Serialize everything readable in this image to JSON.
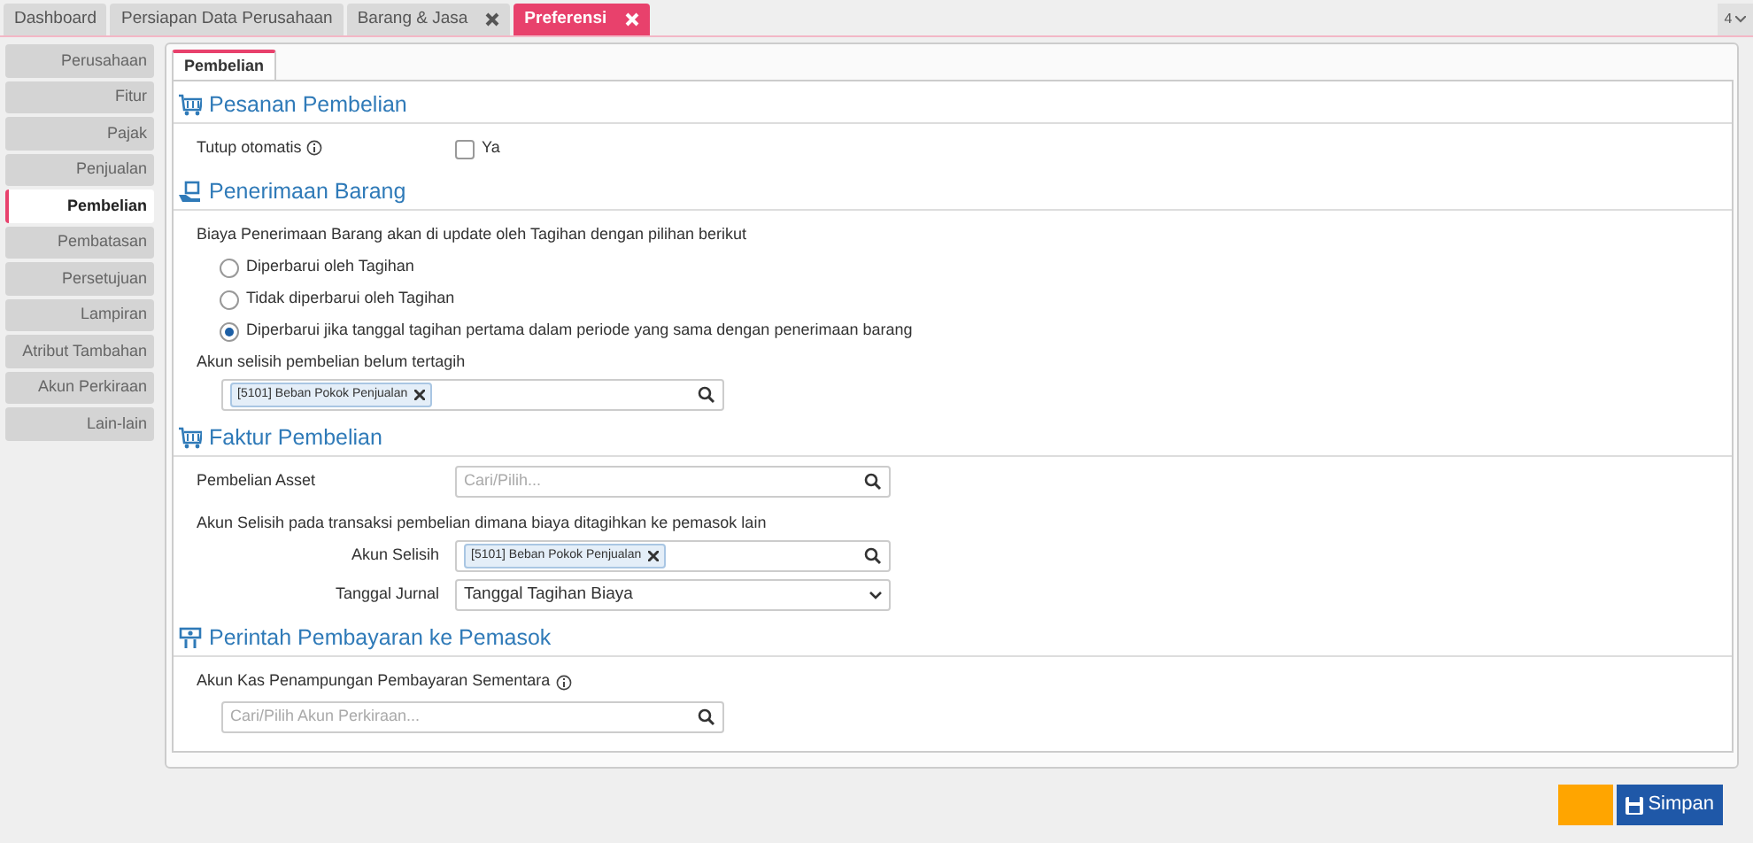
{
  "top_tabs": [
    {
      "label": "Dashboard",
      "closable": false,
      "selected": false
    },
    {
      "label": "Persiapan Data Perusahaan",
      "closable": false,
      "selected": false
    },
    {
      "label": "Barang & Jasa",
      "closable": true,
      "selected": false
    },
    {
      "label": "Preferensi",
      "closable": true,
      "selected": true
    }
  ],
  "tab_counter": "4",
  "sidebar": {
    "items": [
      {
        "label": "Perusahaan",
        "selected": false
      },
      {
        "label": "Fitur",
        "selected": false
      },
      {
        "label": "Pajak",
        "selected": false
      },
      {
        "label": "Penjualan",
        "selected": false
      },
      {
        "label": "Pembelian",
        "selected": true
      },
      {
        "label": "Pembatasan",
        "selected": false
      },
      {
        "label": "Persetujuan",
        "selected": false
      },
      {
        "label": "Lampiran",
        "selected": false
      },
      {
        "label": "Atribut Tambahan",
        "selected": false
      },
      {
        "label": "Akun Perkiraan",
        "selected": false
      },
      {
        "label": "Lain-lain",
        "selected": false
      }
    ]
  },
  "form_tabs": [
    {
      "label": "Pembelian",
      "selected": true
    }
  ],
  "sections": [
    {
      "title": "Pesanan Pembelian",
      "rows": [
        {
          "kind": "checkbox",
          "label": "Tutup otomatis",
          "info": true,
          "option": "Ya",
          "checked": false
        }
      ]
    },
    {
      "title": "Penerimaan Barang",
      "rows": [
        {
          "kind": "text",
          "text": "Biaya Penerimaan Barang akan di update oleh Tagihan dengan pilihan berikut"
        },
        {
          "kind": "radio",
          "label": "Diperbarui oleh Tagihan",
          "selected": false
        },
        {
          "kind": "radio",
          "label": "Tidak diperbarui oleh Tagihan",
          "selected": false
        },
        {
          "kind": "radio",
          "label": "Diperbarui jika tanggal tagihan pertama dalam periode yang sama dengan penerimaan barang",
          "selected": true
        },
        {
          "kind": "text",
          "text": "Akun selisih pembelian belum tertagih"
        },
        {
          "kind": "field",
          "tag": "[5101] Beban Pokok Penjualan"
        }
      ]
    },
    {
      "title": "Faktur Pembelian",
      "rows": [
        {
          "kind": "field",
          "label": "Pembelian Asset",
          "placeholder": "Cari/Pilih..."
        },
        {
          "kind": "text",
          "text": "Akun Selisih pada transaksi pembelian dimana biaya ditagihkan ke pemasok lain"
        },
        {
          "kind": "subfield",
          "label": "Akun Selisih",
          "tag": "[5101] Beban Pokok Penjualan"
        },
        {
          "kind": "select",
          "label": "Tanggal Jurnal",
          "value": "Tanggal Tagihan Biaya"
        }
      ]
    },
    {
      "title": "Perintah Pembayaran ke Pemasok",
      "rows": [
        {
          "kind": "text",
          "text": "Akun Kas Penampungan Pembayaran Sementara",
          "info": true
        },
        {
          "kind": "field",
          "placeholder": "Cari/Pilih Akun Perkiraan..."
        }
      ]
    }
  ],
  "buttons": [
    {
      "kind": "blank"
    },
    {
      "kind": "save",
      "label": "Simpan"
    }
  ]
}
